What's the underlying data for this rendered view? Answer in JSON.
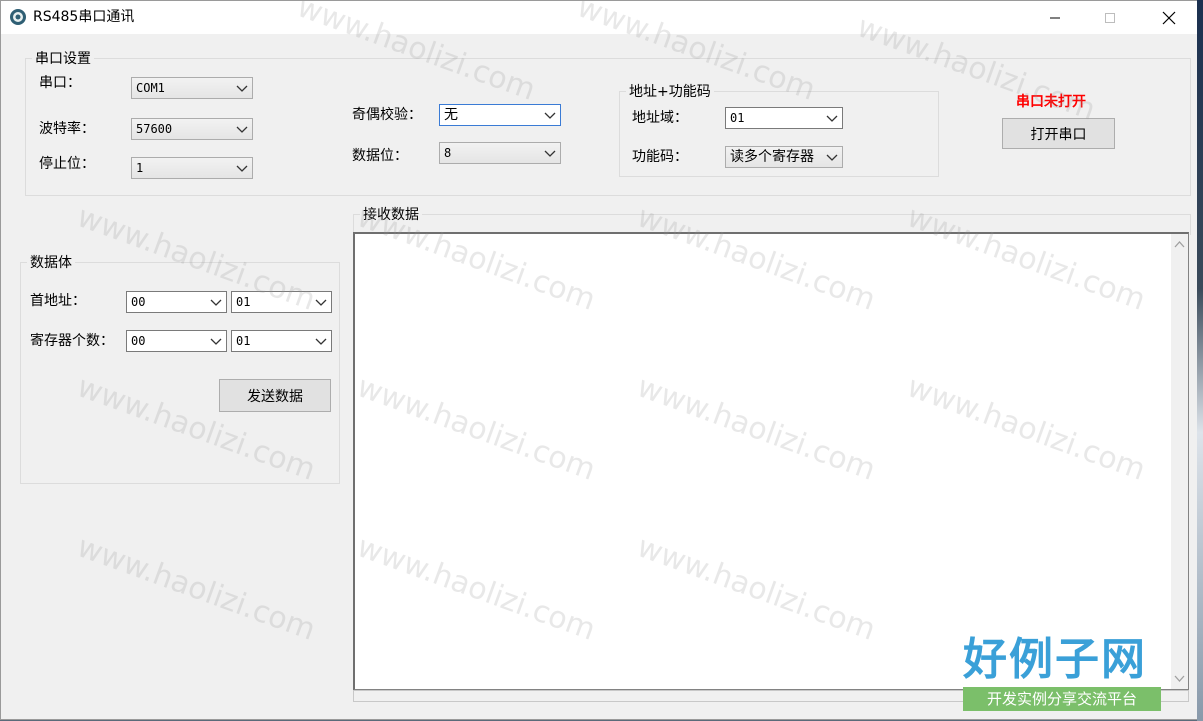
{
  "window": {
    "title": "RS485串口通讯",
    "icon": "gear-app-icon",
    "controls": [
      "minimize-icon",
      "maximize-icon",
      "close-icon"
    ]
  },
  "serial_settings": {
    "group_title": "串口设置",
    "port_label": "串口：",
    "port_value": "COM1",
    "baud_label": "波特率：",
    "baud_value": "57600",
    "stop_label": "停止位：",
    "stop_value": "1",
    "parity_label": "奇偶校验：",
    "parity_value": "无",
    "databits_label": "数据位：",
    "databits_value": "8"
  },
  "addr_func": {
    "group_title": "地址+功能码",
    "addr_label": "地址域：",
    "addr_value": "01",
    "func_label": "功能码：",
    "func_value": "读多个寄存器"
  },
  "port_status": {
    "text": "串口未打开",
    "color": "#ff0000",
    "open_button": "打开串口"
  },
  "data_body": {
    "group_title": "数据体",
    "start_addr_label": "首地址：",
    "start_addr_hi": "00",
    "start_addr_lo": "01",
    "reg_count_label": "寄存器个数：",
    "reg_count_hi": "00",
    "reg_count_lo": "01",
    "send_button": "发送数据"
  },
  "receive": {
    "group_title": "接收数据",
    "content": ""
  },
  "watermark": {
    "text": "www.haolizi.com",
    "logo_main": "好例子网",
    "logo_sub": "开发实例分享交流平台"
  }
}
